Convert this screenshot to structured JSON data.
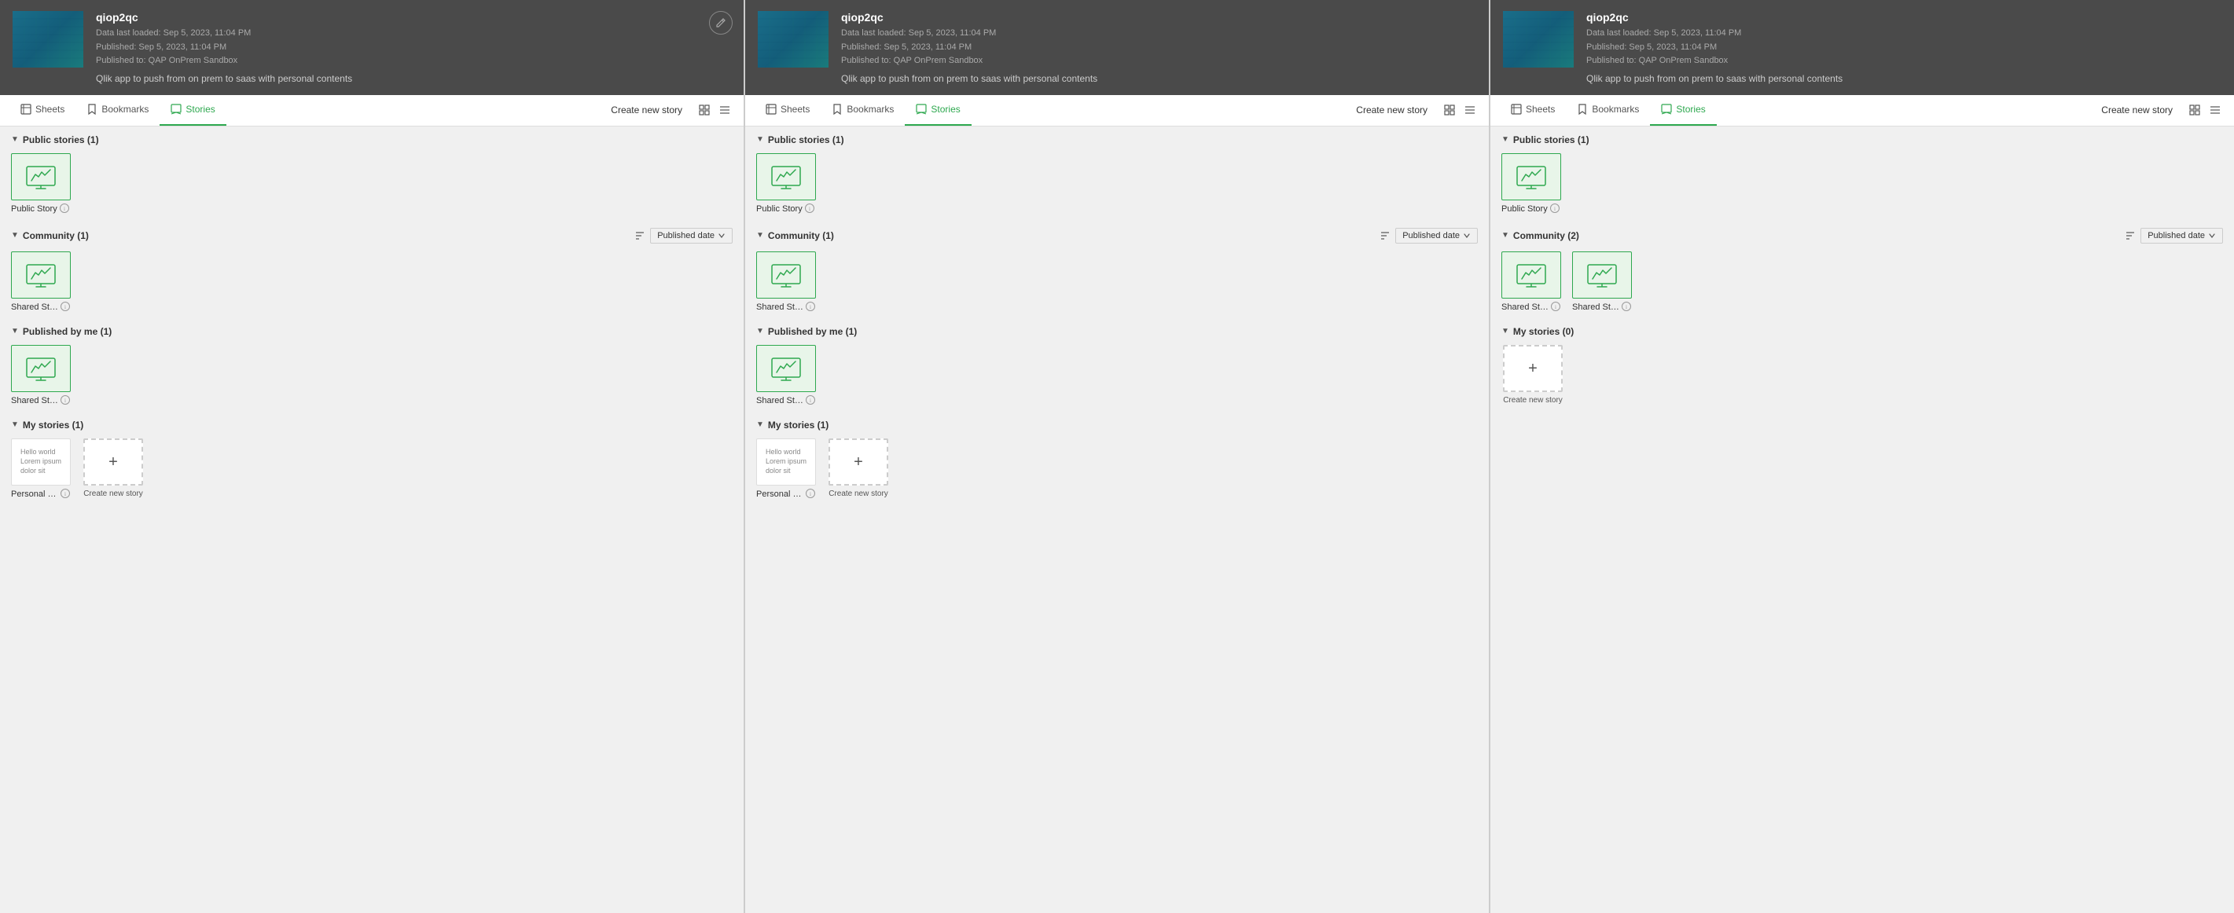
{
  "panels": [
    {
      "id": "panel-1",
      "header": {
        "app_id": "qiop2qc",
        "data_last_loaded": "Data last loaded: Sep 5, 2023, 11:04 PM",
        "published": "Published: Sep 5, 2023, 11:04 PM",
        "published_to": "Published to: QAP OnPrem Sandbox",
        "description": "Qlik app to push from on prem to saas with personal contents"
      },
      "tabs": {
        "sheets_label": "Sheets",
        "bookmarks_label": "Bookmarks",
        "stories_label": "Stories",
        "active": "Stories",
        "create_story_label": "Create new story"
      },
      "sections": [
        {
          "id": "public-stories",
          "title": "Public stories (1)",
          "expanded": true,
          "show_sort": false,
          "items": [
            {
              "id": "ps1",
              "label": "Public Story",
              "type": "story"
            }
          ]
        },
        {
          "id": "community",
          "title": "Community (1)",
          "expanded": true,
          "show_sort": true,
          "sort_label": "Published date",
          "items": [
            {
              "id": "cs1",
              "label": "Shared Story (bob)",
              "type": "story"
            }
          ]
        },
        {
          "id": "published-by-me",
          "title": "Published by me (1)",
          "expanded": true,
          "show_sort": false,
          "items": [
            {
              "id": "pbm1",
              "label": "Shared Story (rvr)",
              "type": "story"
            }
          ]
        },
        {
          "id": "my-stories",
          "title": "My stories (1)",
          "expanded": true,
          "show_sort": false,
          "items": [
            {
              "id": "ms1",
              "label": "Personal Story (rvr)",
              "type": "personal"
            },
            {
              "id": "ms-create",
              "label": "Create new story",
              "type": "create"
            }
          ]
        }
      ]
    },
    {
      "id": "panel-2",
      "header": {
        "app_id": "qiop2qc",
        "data_last_loaded": "Data last loaded: Sep 5, 2023, 11:04 PM",
        "published": "Published: Sep 5, 2023, 11:04 PM",
        "published_to": "Published to: QAP OnPrem Sandbox",
        "description": "Qlik app to push from on prem to saas with personal contents"
      },
      "tabs": {
        "sheets_label": "Sheets",
        "bookmarks_label": "Bookmarks",
        "stories_label": "Stories",
        "active": "Stories",
        "create_story_label": "Create new story"
      },
      "sections": [
        {
          "id": "public-stories",
          "title": "Public stories (1)",
          "expanded": true,
          "show_sort": false,
          "items": [
            {
              "id": "ps1",
              "label": "Public Story",
              "type": "story"
            }
          ]
        },
        {
          "id": "community",
          "title": "Community (1)",
          "expanded": true,
          "show_sort": true,
          "sort_label": "Published date",
          "items": [
            {
              "id": "cs1",
              "label": "Shared Story (rvr)",
              "type": "story"
            }
          ]
        },
        {
          "id": "published-by-me",
          "title": "Published by me (1)",
          "expanded": true,
          "show_sort": false,
          "items": [
            {
              "id": "pbm1",
              "label": "Shared Story (bob)",
              "type": "story"
            }
          ]
        },
        {
          "id": "my-stories",
          "title": "My stories (1)",
          "expanded": true,
          "show_sort": false,
          "items": [
            {
              "id": "ms1",
              "label": "Personal Story (bob)",
              "type": "personal"
            },
            {
              "id": "ms-create",
              "label": "Create new story",
              "type": "create"
            }
          ]
        }
      ]
    },
    {
      "id": "panel-3",
      "header": {
        "app_id": "qiop2qc",
        "data_last_loaded": "Data last loaded: Sep 5, 2023, 11:04 PM",
        "published": "Published: Sep 5, 2023, 11:04 PM",
        "published_to": "Published to: QAP OnPrem Sandbox",
        "description": "Qlik app to push from on prem to saas with personal contents"
      },
      "tabs": {
        "sheets_label": "Sheets",
        "bookmarks_label": "Bookmarks",
        "stories_label": "Stories",
        "active": "Stories",
        "create_story_label": "Create new story"
      },
      "sections": [
        {
          "id": "public-stories",
          "title": "Public stories (1)",
          "expanded": true,
          "show_sort": false,
          "items": [
            {
              "id": "ps1",
              "label": "Public Story",
              "type": "story"
            }
          ]
        },
        {
          "id": "community",
          "title": "Community (2)",
          "expanded": true,
          "show_sort": true,
          "sort_label": "Published date",
          "items": [
            {
              "id": "cs1",
              "label": "Shared Story (rvr)",
              "type": "story"
            },
            {
              "id": "cs2",
              "label": "Shared Story (bob)",
              "type": "story"
            }
          ]
        },
        {
          "id": "my-stories",
          "title": "My stories (0)",
          "expanded": true,
          "show_sort": false,
          "items": [
            {
              "id": "ms-create",
              "label": "Create new story",
              "type": "create"
            }
          ]
        }
      ]
    }
  ]
}
